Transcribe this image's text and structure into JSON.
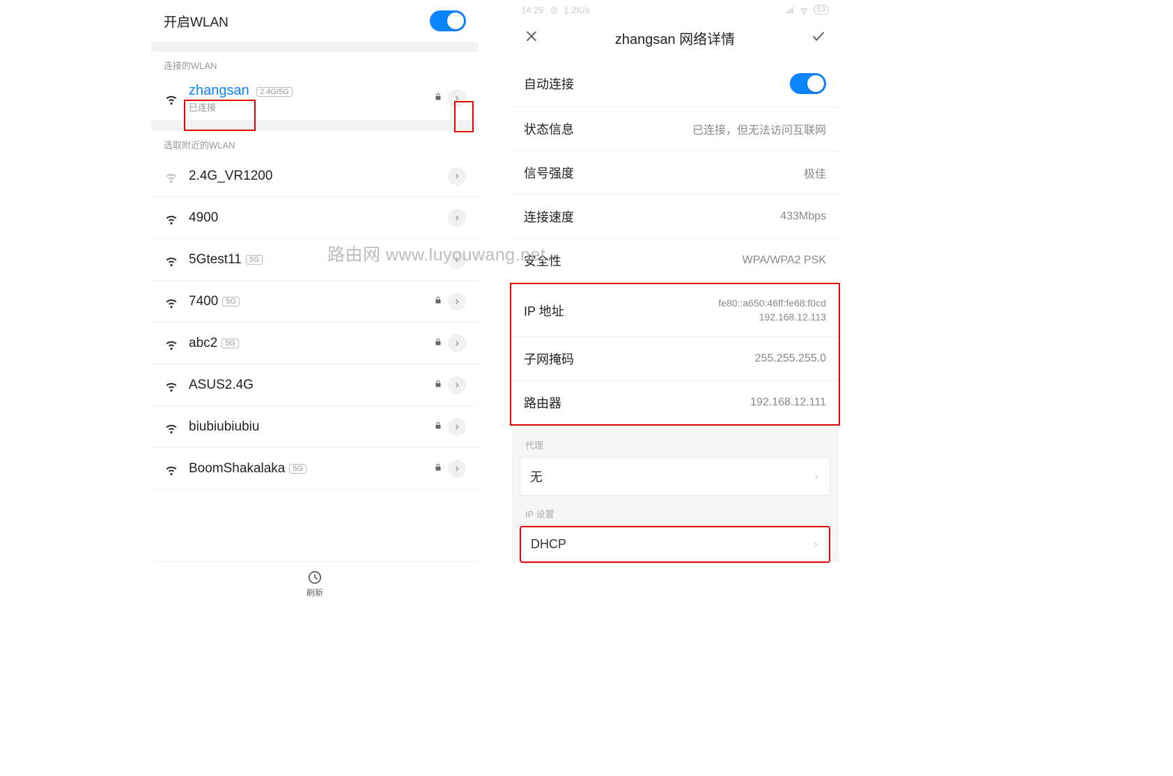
{
  "left": {
    "wlan_toggle_label": "开启WLAN",
    "connected_header": "连接的WLAN",
    "connected": {
      "name": "zhangsan",
      "badge": "2.4G/5G",
      "status": "已连接"
    },
    "nearby_header": "选取附近的WLAN",
    "networks": [
      {
        "name": "2.4G_VR1200",
        "badge": "",
        "locked": false,
        "strength": "weak"
      },
      {
        "name": "4900",
        "badge": "",
        "locked": false,
        "strength": "strong"
      },
      {
        "name": "5Gtest11",
        "badge": "5G",
        "locked": false,
        "strength": "strong"
      },
      {
        "name": "7400",
        "badge": "5G",
        "locked": true,
        "strength": "strong"
      },
      {
        "name": "abc2",
        "badge": "5G",
        "locked": true,
        "strength": "strong"
      },
      {
        "name": "ASUS2.4G",
        "badge": "",
        "locked": true,
        "strength": "strong"
      },
      {
        "name": "biubiubiubiu",
        "badge": "",
        "locked": true,
        "strength": "strong"
      },
      {
        "name": "BoomShakalaka",
        "badge": "5G",
        "locked": true,
        "strength": "strong"
      }
    ],
    "refresh_label": "刷新"
  },
  "right": {
    "status_time": "14:26",
    "status_speed": "1.2K/s",
    "status_battery": "53",
    "title": "zhangsan  网络详情",
    "auto_connect_label": "自动连接",
    "rows": {
      "status": {
        "label": "状态信息",
        "value": "已连接，但无法访问互联网"
      },
      "signal": {
        "label": "信号强度",
        "value": "极佳"
      },
      "speed": {
        "label": "连接速度",
        "value": "433Mbps"
      },
      "security": {
        "label": "安全性",
        "value": "WPA/WPA2 PSK"
      },
      "ip": {
        "label": "IP 地址",
        "value1": "fe80::a650:46ff:fe68:f0cd",
        "value2": "192.168.12.113"
      },
      "mask": {
        "label": "子网掩码",
        "value": "255.255.255.0"
      },
      "router": {
        "label": "路由器",
        "value": "192.168.12.111"
      }
    },
    "proxy": {
      "label": "代理",
      "value": "无"
    },
    "ip_setting": {
      "label": "IP 设置",
      "value": "DHCP"
    }
  },
  "watermark": "路由网 www.luyouwang.net"
}
